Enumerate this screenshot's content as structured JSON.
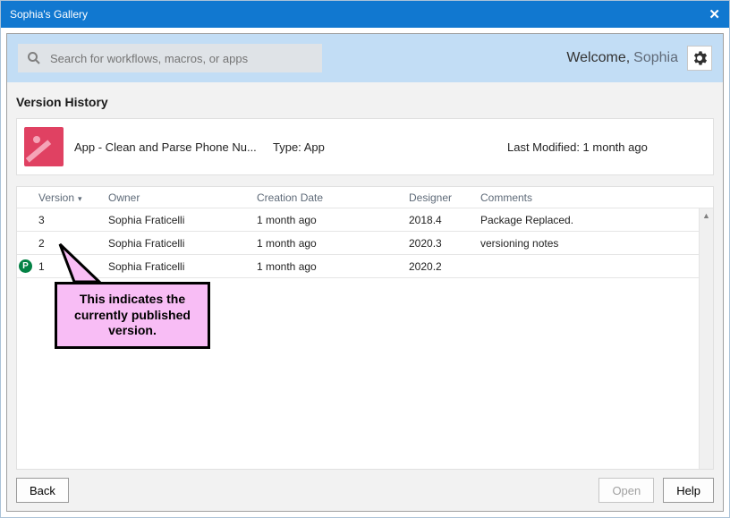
{
  "window": {
    "title": "Sophia's Gallery"
  },
  "search": {
    "placeholder": "Search for workflows, macros, or apps"
  },
  "welcome": {
    "prefix": "Welcome,",
    "name": "Sophia"
  },
  "section_title": "Version History",
  "asset": {
    "name": "App - Clean and Parse Phone Nu...",
    "type_label": "Type: App",
    "modified_label": "Last Modified: 1 month ago"
  },
  "columns": {
    "version": "Version",
    "owner": "Owner",
    "creation_date": "Creation Date",
    "designer": "Designer",
    "comments": "Comments"
  },
  "rows": [
    {
      "published": false,
      "version": "3",
      "owner": "Sophia Fraticelli",
      "creation_date": "1 month ago",
      "designer": "2018.4",
      "comments": "Package Replaced."
    },
    {
      "published": false,
      "version": "2",
      "owner": "Sophia Fraticelli",
      "creation_date": "1 month ago",
      "designer": "2020.3",
      "comments": "versioning notes"
    },
    {
      "published": true,
      "version": "1",
      "owner": "Sophia Fraticelli",
      "creation_date": "1 month ago",
      "designer": "2020.2",
      "comments": ""
    }
  ],
  "published_badge": "P",
  "callout": {
    "text": "This indicates the currently published version."
  },
  "footer": {
    "back": "Back",
    "open": "Open",
    "help": "Help"
  }
}
